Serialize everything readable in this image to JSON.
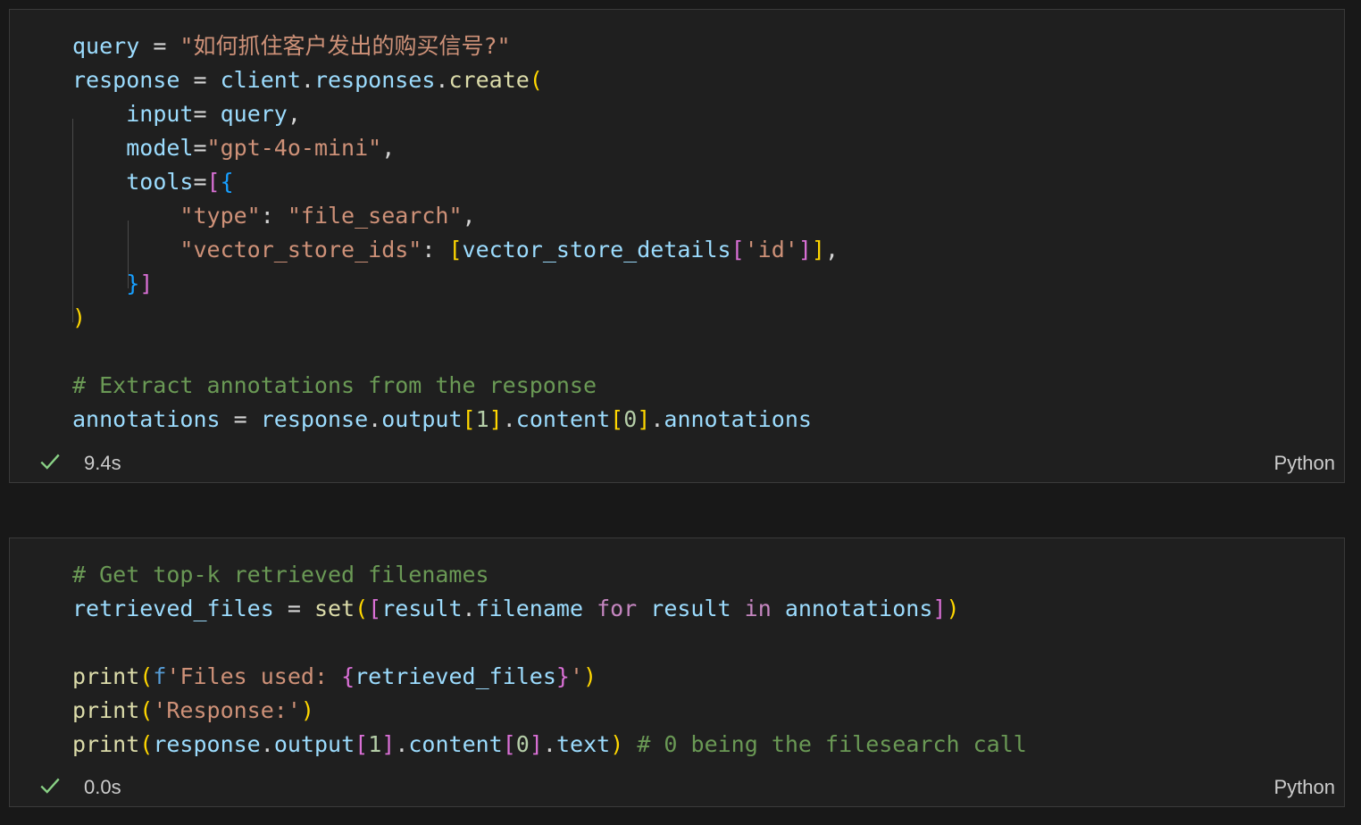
{
  "cells": [
    {
      "lines": [
        [
          {
            "t": "query",
            "c": "var"
          },
          {
            "t": " = ",
            "c": "op"
          },
          {
            "t": "\"如何抓住客户发出的购买信号?\"",
            "c": "str"
          }
        ],
        [
          {
            "t": "response",
            "c": "var"
          },
          {
            "t": " = ",
            "c": "op"
          },
          {
            "t": "client",
            "c": "var"
          },
          {
            "t": ".",
            "c": "op"
          },
          {
            "t": "responses",
            "c": "var"
          },
          {
            "t": ".",
            "c": "op"
          },
          {
            "t": "create",
            "c": "fn"
          },
          {
            "t": "(",
            "c": "bk1"
          }
        ],
        [
          {
            "t": "    ",
            "c": "op"
          },
          {
            "t": "input",
            "c": "var"
          },
          {
            "t": "= ",
            "c": "op"
          },
          {
            "t": "query",
            "c": "var"
          },
          {
            "t": ",",
            "c": "op"
          }
        ],
        [
          {
            "t": "    ",
            "c": "op"
          },
          {
            "t": "model",
            "c": "var"
          },
          {
            "t": "=",
            "c": "op"
          },
          {
            "t": "\"gpt-4o-mini\"",
            "c": "str"
          },
          {
            "t": ",",
            "c": "op"
          }
        ],
        [
          {
            "t": "    ",
            "c": "op"
          },
          {
            "t": "tools",
            "c": "var"
          },
          {
            "t": "=",
            "c": "op"
          },
          {
            "t": "[",
            "c": "bk2"
          },
          {
            "t": "{",
            "c": "bk3"
          }
        ],
        [
          {
            "t": "        ",
            "c": "op"
          },
          {
            "t": "\"type\"",
            "c": "str"
          },
          {
            "t": ": ",
            "c": "op"
          },
          {
            "t": "\"file_search\"",
            "c": "str"
          },
          {
            "t": ",",
            "c": "op"
          }
        ],
        [
          {
            "t": "        ",
            "c": "op"
          },
          {
            "t": "\"vector_store_ids\"",
            "c": "str"
          },
          {
            "t": ": ",
            "c": "op"
          },
          {
            "t": "[",
            "c": "bk1"
          },
          {
            "t": "vector_store_details",
            "c": "var"
          },
          {
            "t": "[",
            "c": "bk2"
          },
          {
            "t": "'id'",
            "c": "str"
          },
          {
            "t": "]",
            "c": "bk2"
          },
          {
            "t": "]",
            "c": "bk1"
          },
          {
            "t": ",",
            "c": "op"
          }
        ],
        [
          {
            "t": "    ",
            "c": "op"
          },
          {
            "t": "}",
            "c": "bk3"
          },
          {
            "t": "]",
            "c": "bk2"
          }
        ],
        [
          {
            "t": ")",
            "c": "bk1"
          }
        ],
        [],
        [
          {
            "t": "# Extract annotations from the response",
            "c": "com"
          }
        ],
        [
          {
            "t": "annotations",
            "c": "var"
          },
          {
            "t": " = ",
            "c": "op"
          },
          {
            "t": "response",
            "c": "var"
          },
          {
            "t": ".",
            "c": "op"
          },
          {
            "t": "output",
            "c": "var"
          },
          {
            "t": "[",
            "c": "bk1"
          },
          {
            "t": "1",
            "c": "num"
          },
          {
            "t": "]",
            "c": "bk1"
          },
          {
            "t": ".",
            "c": "op"
          },
          {
            "t": "content",
            "c": "var"
          },
          {
            "t": "[",
            "c": "bk1"
          },
          {
            "t": "0",
            "c": "num"
          },
          {
            "t": "]",
            "c": "bk1"
          },
          {
            "t": ".",
            "c": "op"
          },
          {
            "t": "annotations",
            "c": "var"
          }
        ]
      ],
      "exec_time": "9.4s",
      "language": "Python"
    },
    {
      "lines": [
        [
          {
            "t": "# Get top-k retrieved filenames",
            "c": "com"
          }
        ],
        [
          {
            "t": "retrieved_files",
            "c": "var"
          },
          {
            "t": " = ",
            "c": "op"
          },
          {
            "t": "set",
            "c": "fn"
          },
          {
            "t": "(",
            "c": "bk1"
          },
          {
            "t": "[",
            "c": "bk2"
          },
          {
            "t": "result",
            "c": "var"
          },
          {
            "t": ".",
            "c": "op"
          },
          {
            "t": "filename",
            "c": "var"
          },
          {
            "t": " for ",
            "c": "kw"
          },
          {
            "t": "result",
            "c": "var"
          },
          {
            "t": " in ",
            "c": "kw"
          },
          {
            "t": "annotations",
            "c": "var"
          },
          {
            "t": "]",
            "c": "bk2"
          },
          {
            "t": ")",
            "c": "bk1"
          }
        ],
        [],
        [
          {
            "t": "print",
            "c": "fn"
          },
          {
            "t": "(",
            "c": "bk1"
          },
          {
            "t": "f",
            "c": "fstr"
          },
          {
            "t": "'Files used: ",
            "c": "str"
          },
          {
            "t": "{",
            "c": "bk2"
          },
          {
            "t": "retrieved_files",
            "c": "var"
          },
          {
            "t": "}",
            "c": "bk2"
          },
          {
            "t": "'",
            "c": "str"
          },
          {
            "t": ")",
            "c": "bk1"
          }
        ],
        [
          {
            "t": "print",
            "c": "fn"
          },
          {
            "t": "(",
            "c": "bk1"
          },
          {
            "t": "'Response:'",
            "c": "str"
          },
          {
            "t": ")",
            "c": "bk1"
          }
        ],
        [
          {
            "t": "print",
            "c": "fn"
          },
          {
            "t": "(",
            "c": "bk1"
          },
          {
            "t": "response",
            "c": "var"
          },
          {
            "t": ".",
            "c": "op"
          },
          {
            "t": "output",
            "c": "var"
          },
          {
            "t": "[",
            "c": "bk2"
          },
          {
            "t": "1",
            "c": "num"
          },
          {
            "t": "]",
            "c": "bk2"
          },
          {
            "t": ".",
            "c": "op"
          },
          {
            "t": "content",
            "c": "var"
          },
          {
            "t": "[",
            "c": "bk2"
          },
          {
            "t": "0",
            "c": "num"
          },
          {
            "t": "]",
            "c": "bk2"
          },
          {
            "t": ".",
            "c": "op"
          },
          {
            "t": "text",
            "c": "var"
          },
          {
            "t": ")",
            "c": "bk1"
          },
          {
            "t": " # 0 being the filesearch call",
            "c": "com"
          }
        ]
      ],
      "exec_time": "0.0s",
      "language": "Python"
    }
  ],
  "icons": {
    "status": "check-icon"
  },
  "colors": {
    "success": "#89d185",
    "background": "#181818",
    "cell_background": "#1f1f1f"
  }
}
